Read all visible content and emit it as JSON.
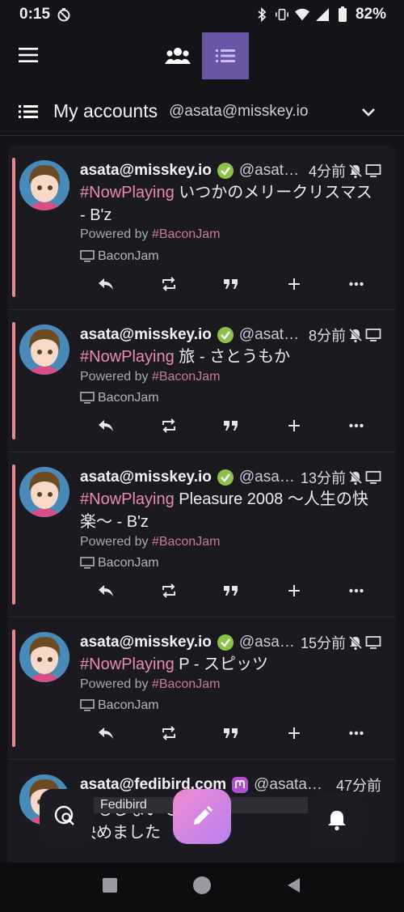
{
  "status": {
    "time": "0:15",
    "battery": "82%"
  },
  "header": {
    "title": "My accounts",
    "handle": "@asata@misskey.io"
  },
  "posts": [
    {
      "name": "asata@misskey.io",
      "handle": "@asata@misskey.io",
      "time": "4分前",
      "hashtag": "#NowPlaying",
      "text": " いつかのメリークリスマス - B'z",
      "powered_prefix": "Powered by ",
      "powered_tag": "#BaconJam",
      "via": "BaconJam"
    },
    {
      "name": "asata@misskey.io",
      "handle": "@asata@misskey.io",
      "time": "8分前",
      "hashtag": "#NowPlaying",
      "text": " 旅 - さとうもか",
      "powered_prefix": "Powered by ",
      "powered_tag": "#BaconJam",
      "via": "BaconJam"
    },
    {
      "name": "asata@misskey.io",
      "handle": "@asata@misskey.io",
      "time": "13分前",
      "hashtag": "#NowPlaying",
      "text": " Pleasure 2008 ～人生の快楽～ - B'z",
      "powered_prefix": "Powered by ",
      "powered_tag": "#BaconJam",
      "via": "BaconJam"
    },
    {
      "name": "asata@misskey.io",
      "handle": "@asata@misskey.io",
      "time": "15分前",
      "hashtag": "#NowPlaying",
      "text": " P - スピッツ",
      "powered_prefix": "Powered by ",
      "powered_tag": "#BaconJam",
      "via": "BaconJam"
    },
    {
      "name": "asata@fedibird.com",
      "handle": "@asata@fedibird.com",
      "time": "47分前",
      "text_line1": "もしないで",
      "text_line2": "決めました"
    }
  ],
  "compose": {
    "account_tag": "Fedibird"
  },
  "colors": {
    "accent": "#6a54a4",
    "hashtag": "#e98ab7",
    "post_bar": "#e88a8a",
    "verified": "#8bc34a"
  }
}
